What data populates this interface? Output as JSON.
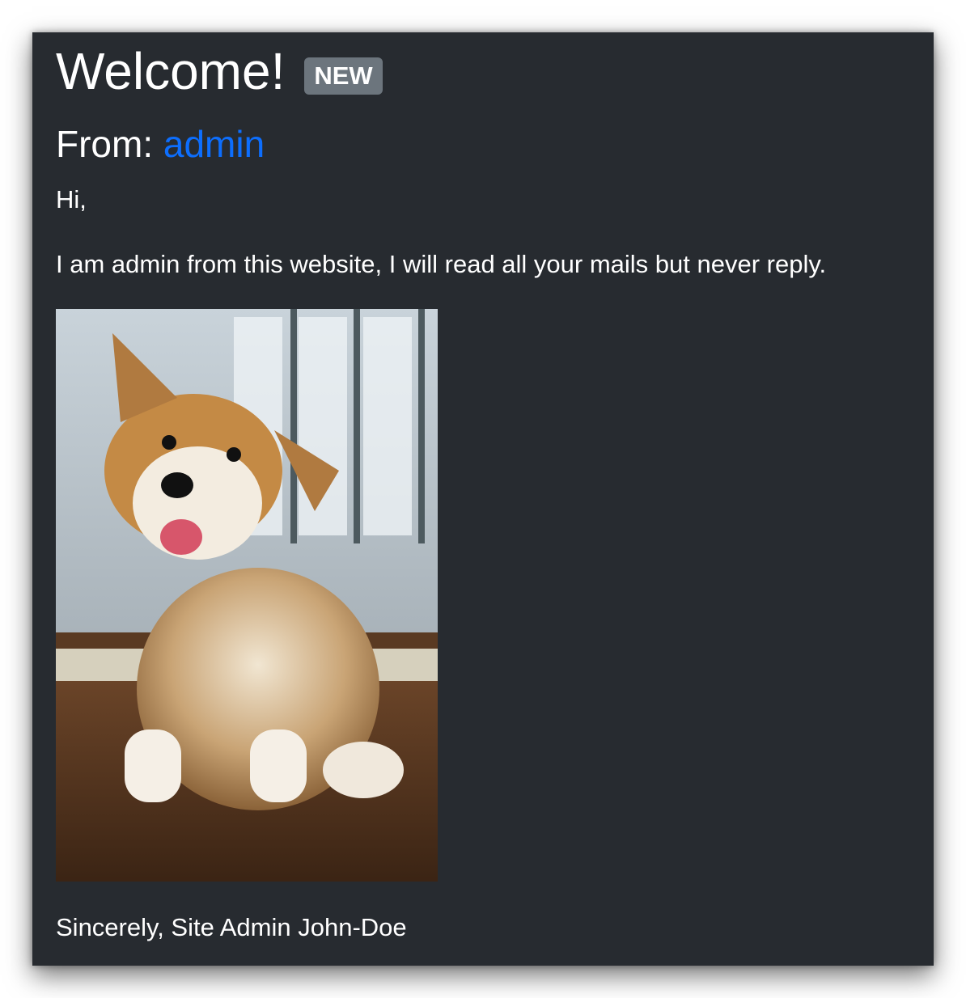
{
  "message": {
    "title": "Welcome!",
    "badge": "NEW",
    "from_label": "From:",
    "from_user": "admin",
    "greeting": "Hi,",
    "body": "I am admin from this website, I will read all your mails but never reply.",
    "image_alt": "corgi puppy photo",
    "signature": "Sincerely, Site Admin John-Doe"
  },
  "colors": {
    "background": "#272b30",
    "badge": "#6c757d",
    "link": "#0d6efd"
  }
}
